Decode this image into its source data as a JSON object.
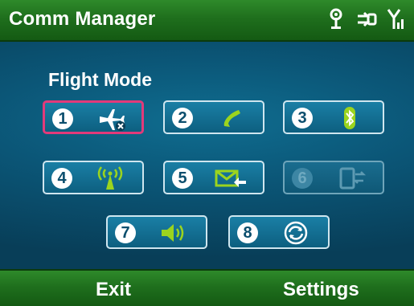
{
  "title": "Comm Manager",
  "heading": "Flight Mode",
  "tiles": [
    {
      "number": "1",
      "name": "flight-mode"
    },
    {
      "number": "2",
      "name": "phone"
    },
    {
      "number": "3",
      "name": "bluetooth"
    },
    {
      "number": "4",
      "name": "wireless"
    },
    {
      "number": "5",
      "name": "data-sync"
    },
    {
      "number": "6",
      "name": "activesync"
    },
    {
      "number": "7",
      "name": "sound"
    },
    {
      "number": "8",
      "name": "sync"
    }
  ],
  "softkeys": {
    "left": "Exit",
    "right": "Settings"
  },
  "colors": {
    "title_green": "#1f6f1d",
    "content_blue": "#0b5677",
    "selected_border": "#e23a7a",
    "icon_lime": "#9bd41e"
  }
}
